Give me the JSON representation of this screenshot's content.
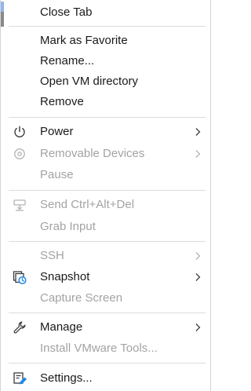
{
  "menu": {
    "items": {
      "close_tab": {
        "label": "Close Tab",
        "enabled": true
      },
      "mark_favorite": {
        "label": "Mark as Favorite",
        "enabled": true
      },
      "rename": {
        "label": "Rename...",
        "enabled": true
      },
      "open_vm_directory": {
        "label": "Open VM directory",
        "enabled": true
      },
      "remove": {
        "label": "Remove",
        "enabled": true
      },
      "power": {
        "label": "Power",
        "enabled": true,
        "icon": "power-icon",
        "submenu": true
      },
      "removable_devices": {
        "label": "Removable Devices",
        "enabled": false,
        "icon": "disc-icon",
        "submenu": true
      },
      "pause": {
        "label": "Pause",
        "enabled": false
      },
      "send_ctrl_alt_del": {
        "label": "Send Ctrl+Alt+Del",
        "enabled": false,
        "icon": "keyboard-send-icon"
      },
      "grab_input": {
        "label": "Grab Input",
        "enabled": false
      },
      "ssh": {
        "label": "SSH",
        "enabled": false,
        "submenu": true
      },
      "snapshot": {
        "label": "Snapshot",
        "enabled": true,
        "icon": "snapshot-icon",
        "submenu": true
      },
      "capture_screen": {
        "label": "Capture Screen",
        "enabled": false
      },
      "manage": {
        "label": "Manage",
        "enabled": true,
        "icon": "wrench-icon",
        "submenu": true
      },
      "install_vmware_tools": {
        "label": "Install VMware Tools...",
        "enabled": false
      },
      "settings": {
        "label": "Settings...",
        "enabled": true,
        "icon": "settings-icon"
      }
    }
  },
  "colors": {
    "text": "#1a1a1a",
    "disabled_text": "#a3a3a3",
    "separator": "#dcdcdc",
    "accent": "#1e88e5"
  }
}
